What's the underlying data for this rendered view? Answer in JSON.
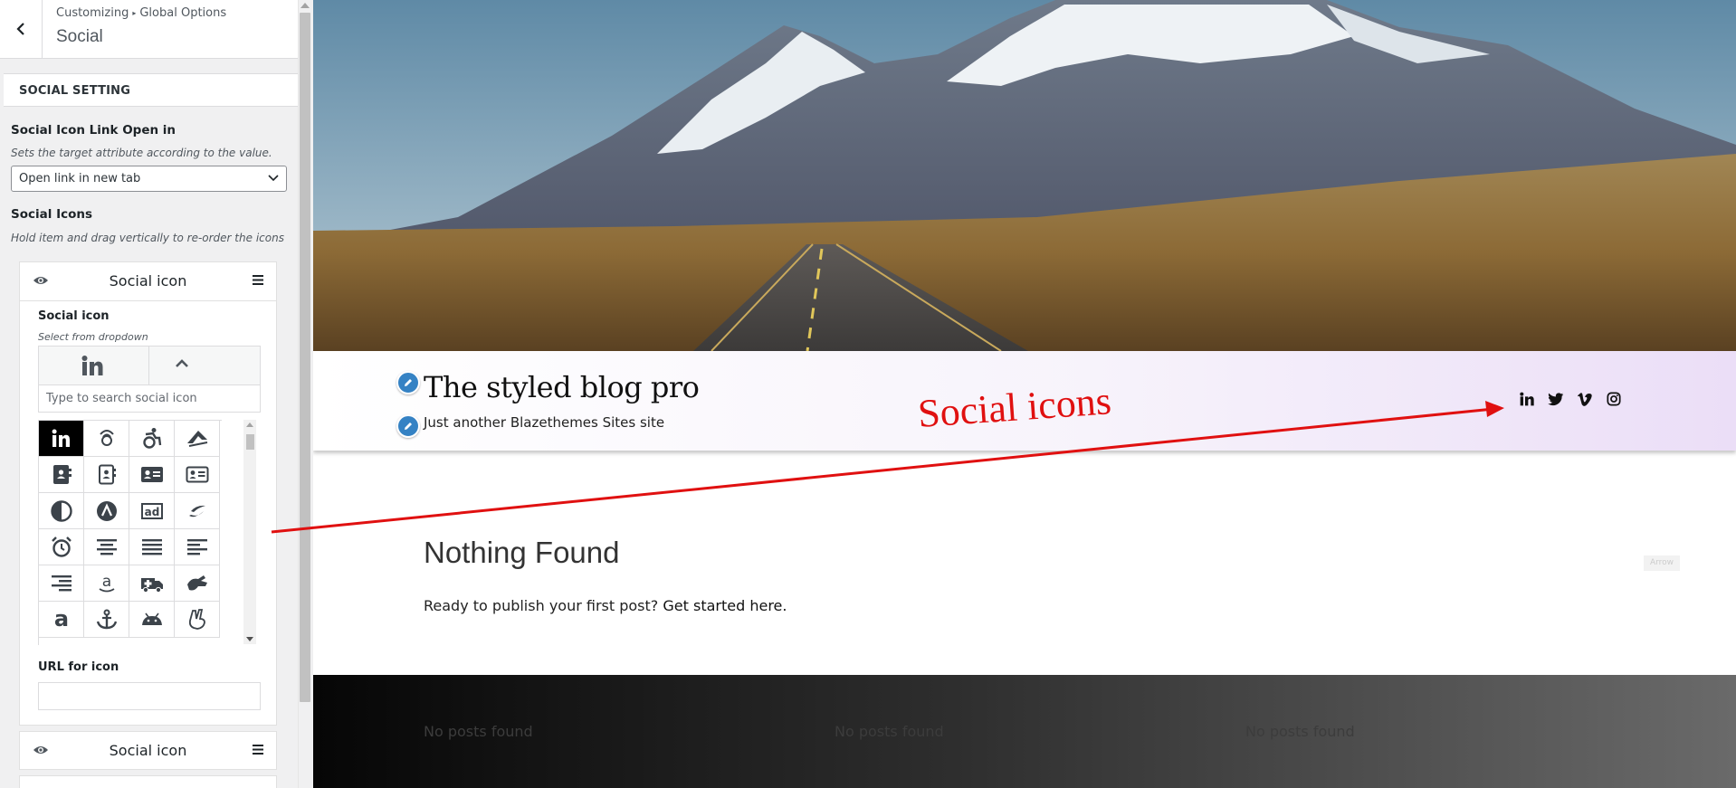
{
  "sidebar": {
    "breadcrumb": [
      "Customizing",
      "Global Options"
    ],
    "breadcrumb_sep": "▸",
    "section_title": "Social",
    "setting_heading": "SOCIAL SETTING",
    "link_open": {
      "label": "Social Icon Link Open in",
      "description": "Sets the target attribute according to the value.",
      "value": "Open link in new tab"
    },
    "social_icons": {
      "label": "Social Icons",
      "description": "Hold item and drag vertically to re-order the icons"
    },
    "items": [
      {
        "title": "Social icon",
        "field_label": "Social icon",
        "field_desc": "Select from dropdown",
        "selected_icon": "linkedin-icon",
        "search_placeholder": "Type to search social icon",
        "url_label": "URL for icon",
        "url_value": ""
      },
      {
        "title": "Social icon"
      }
    ],
    "icon_grid": [
      "linkedin-icon",
      "500px-icon",
      "accessible-icon",
      "accusoft-icon",
      "address-book-icon",
      "address-book-outline-icon",
      "address-card-icon",
      "address-card-outline-icon",
      "adjust-icon",
      "adversal-icon",
      "ad-icon",
      "affiliatetheme-icon",
      "alarm-clock-icon",
      "align-center-icon",
      "align-justify-icon",
      "align-left-icon",
      "align-right-icon",
      "amazon-icon",
      "ambulance-icon",
      "american-sign-language-icon",
      "amazon-a-icon",
      "anchor-icon",
      "android-icon",
      "angellist-icon"
    ],
    "icon_grid_labels": {
      "ad": "ad"
    }
  },
  "preview": {
    "site_title": "The styled blog pro",
    "tagline": "Just another Blazethemes Sites site",
    "header_social": [
      "linkedin-icon",
      "twitter-icon",
      "vimeo-icon",
      "instagram-icon"
    ],
    "annotation": "Social icons",
    "nothing_found": {
      "title": "Nothing Found",
      "text": "Ready to publish your first post?",
      "link": "Get started here."
    },
    "badge": "Arrow",
    "footer_columns": [
      "No posts found",
      "No posts found",
      "No posts found"
    ]
  },
  "colors": {
    "accent_blue": "#3582c4",
    "annotation_red": "#e01010",
    "sidebar_bg": "#f0f0f1"
  }
}
